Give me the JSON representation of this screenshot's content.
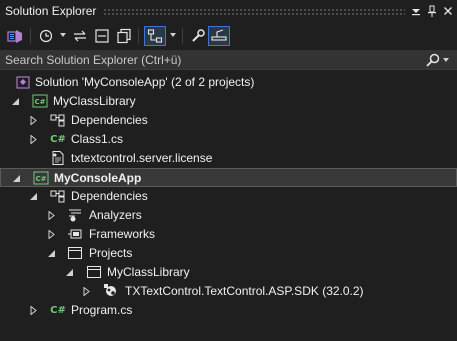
{
  "window": {
    "title": "Solution Explorer"
  },
  "search": {
    "placeholder": "Search Solution Explorer (Ctrl+ü)"
  },
  "tree": {
    "solution": "Solution 'MyConsoleApp' (2 of 2 projects)",
    "myclasslibrary": "MyClassLibrary",
    "deps1": "Dependencies",
    "class1": "Class1.cs",
    "license": "txtextcontrol.server.license",
    "myconsoleapp": "MyConsoleApp",
    "deps2": "Dependencies",
    "analyzers": "Analyzers",
    "frameworks": "Frameworks",
    "projects": "Projects",
    "projref": "MyClassLibrary",
    "package": "TXTextControl.TextControl.ASP.SDK (32.0.2)",
    "program": "Program.cs"
  },
  "icons": {
    "cs_badge": "C#",
    "accent": "#3b78d4",
    "cs_green": "#72c872",
    "vs_purple": "#b180d7"
  }
}
